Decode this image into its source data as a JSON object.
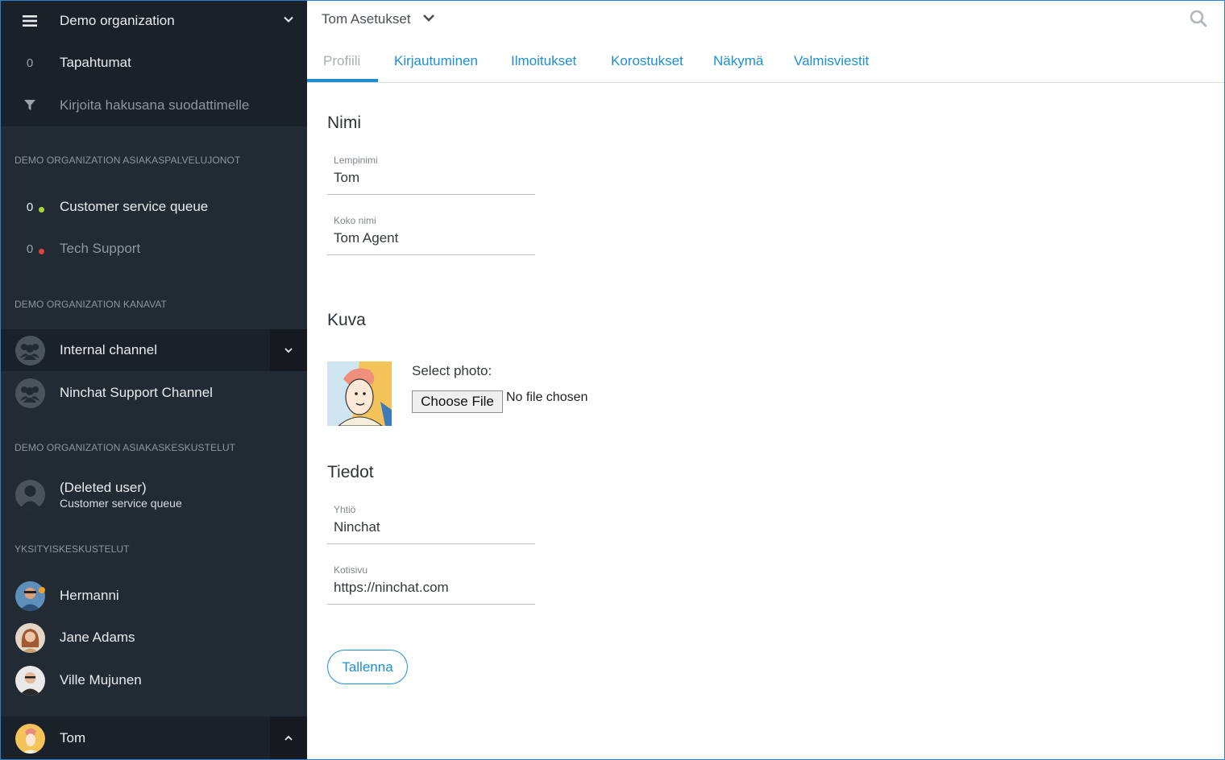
{
  "sidebar": {
    "org": {
      "name": "Demo organization"
    },
    "events": {
      "count": "0",
      "label": "Tapahtumat"
    },
    "filter": {
      "placeholder": "Kirjoita hakusana suodattimelle"
    },
    "queues_header": "DEMO ORGANIZATION ASIAKASPALVELUJONOT",
    "queues": [
      {
        "count": "0",
        "label": "Customer service queue",
        "status_color": "#a6d63a"
      },
      {
        "count": "0",
        "label": "Tech Support",
        "status_color": "#e0443a"
      }
    ],
    "channels_header": "DEMO ORGANIZATION KANAVAT",
    "channels": [
      {
        "label": "Internal channel"
      },
      {
        "label": "Ninchat Support Channel"
      }
    ],
    "conversations_header": "DEMO ORGANIZATION ASIAKASKESKUSTELUT",
    "conversations": [
      {
        "label": "(Deleted user)",
        "sublabel": "Customer service queue"
      }
    ],
    "private_header": "YKSITYISKESKUSTELUT",
    "private": [
      {
        "label": "Hermanni",
        "status_color": "#f0a030"
      },
      {
        "label": "Jane Adams"
      },
      {
        "label": "Ville Mujunen"
      }
    ],
    "user": {
      "name": "Tom"
    }
  },
  "header": {
    "title": "Tom Asetukset"
  },
  "tabs": [
    {
      "label": "Profiili",
      "active": true
    },
    {
      "label": "Kirjautuminen"
    },
    {
      "label": "Ilmoitukset"
    },
    {
      "label": "Korostukset"
    },
    {
      "label": "Näkymä"
    },
    {
      "label": "Valmisviestit"
    }
  ],
  "sections": {
    "name": {
      "title": "Nimi",
      "nickname": {
        "label": "Lempinimi",
        "value": "Tom"
      },
      "fullname": {
        "label": "Koko nimi",
        "value": "Tom Agent"
      }
    },
    "photo": {
      "title": "Kuva",
      "select_label": "Select photo:",
      "choose_button": "Choose File",
      "no_file": "No file chosen"
    },
    "info": {
      "title": "Tiedot",
      "company": {
        "label": "Yhtiö",
        "value": "Ninchat"
      },
      "homepage": {
        "label": "Kotisivu",
        "value": "https://ninchat.com"
      }
    }
  },
  "actions": {
    "save": "Tallenna"
  },
  "colors": {
    "accent": "#1e8fd0",
    "sidebar_bg": "#222a33",
    "sidebar_dark": "#1b2128"
  }
}
